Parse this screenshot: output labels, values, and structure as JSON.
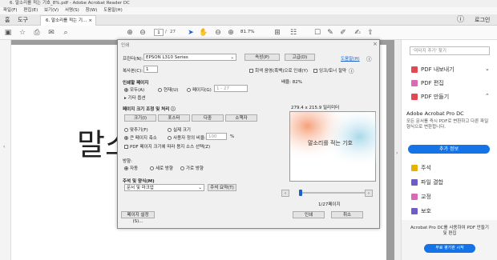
{
  "window_title": "6. 말소리를 적는 기호_8%.pdf - Adobe Acrobat Reader DC",
  "menu": [
    "파일(F)",
    "편집(E)",
    "보기(V)",
    "서명(S)",
    "창(W)",
    "도움말(H)"
  ],
  "tabs": {
    "home": "홈",
    "tools": "도구",
    "doc": "6. 말소리를 적는 기..."
  },
  "help_icon": "?",
  "login": "로그인",
  "toolbar": {
    "page_current": "1",
    "page_sep": "/",
    "page_total": "27",
    "zoom": "81.7%"
  },
  "document": {
    "big_text": "말소"
  },
  "right_panel": {
    "search_placeholder": "'미터지 추가' 찾기",
    "items": [
      "PDF 내보내기",
      "PDF 편집",
      "PDF 만들기"
    ],
    "promo_title": "Adobe Acrobat Pro DC",
    "promo_text": "모든 문서를 즉시 PDF로 변환하고 다른 파일 형식으로 변환합니다.",
    "promo_button": "추가 정보",
    "items2": [
      "주석",
      "파일 결합",
      "교정",
      "보호"
    ],
    "footer_text": "Acrobat Pro DC를 사용하여 PDF 만들기 및 편집",
    "footer_button": "무료 평가판 시작"
  },
  "dialog": {
    "title": "인쇄",
    "printer_label": "프린터(N):",
    "printer_value": "EPSON L310 Series",
    "properties": "속성(P)",
    "advanced": "고급(D)",
    "help": "도움말(H)",
    "copies_label": "복사본(C):",
    "copies_value": "1",
    "grayscale": "회색 음영(흑백)으로 인쇄(Y)",
    "save_ink": "잉크/토너 절약",
    "pages_title": "인쇄할 페이지",
    "all": "모두(A)",
    "current": "현재(U)",
    "pages": "페이지(G)",
    "pages_range": "1 - 27",
    "more_options": "▸ 기타 옵션",
    "sizing_title": "페이지 크기 조정 및 처리",
    "size_btn": "크기(I)",
    "poster_btn": "포스터",
    "multiple_btn": "다중",
    "booklet_btn": "소책자",
    "fit": "맞추기(F)",
    "actual": "실제 크기",
    "shrink": "큰 페이지 축소",
    "custom": "사용자 정의 비율:",
    "custom_value": "100",
    "percent": "%",
    "paper_source": "PDF 페이지 크기에 따라 용지 소스 선택(Z)",
    "orientation_title": "방향:",
    "auto": "자동",
    "portrait": "세로 방향",
    "landscape": "가로 방향",
    "comments_title": "주석 및 양식(M)",
    "comments_value": "문서 및 마크업",
    "summarize": "주석 요약(T)",
    "scale_label": "배율: 82%",
    "paper_size": "279.4 x 215.9 밀리미터",
    "preview_text": "말소리를 적는 기호",
    "page_of": "1/27페이지",
    "page_setup": "페이지 설정(S)...",
    "print": "인쇄",
    "cancel": "취소"
  }
}
